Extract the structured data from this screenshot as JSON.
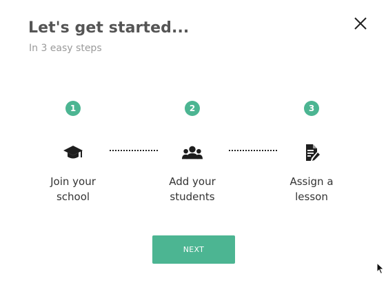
{
  "header": {
    "title": "Let's get started...",
    "subtitle": "In 3 easy steps"
  },
  "close_icon": "close-icon",
  "steps": [
    {
      "number": "1",
      "icon": "school-cap-icon",
      "label_line1": "Join your",
      "label_line2": "school"
    },
    {
      "number": "2",
      "icon": "users-group-icon",
      "label_line1": "Add your",
      "label_line2": "students"
    },
    {
      "number": "3",
      "icon": "document-edit-icon",
      "label_line1": "Assign a",
      "label_line2": "lesson"
    }
  ],
  "actions": {
    "next_label": "NEXT"
  },
  "colors": {
    "accent": "#4cb592",
    "title": "#555555",
    "subtitle": "#9a9a9a",
    "text": "#333333"
  }
}
